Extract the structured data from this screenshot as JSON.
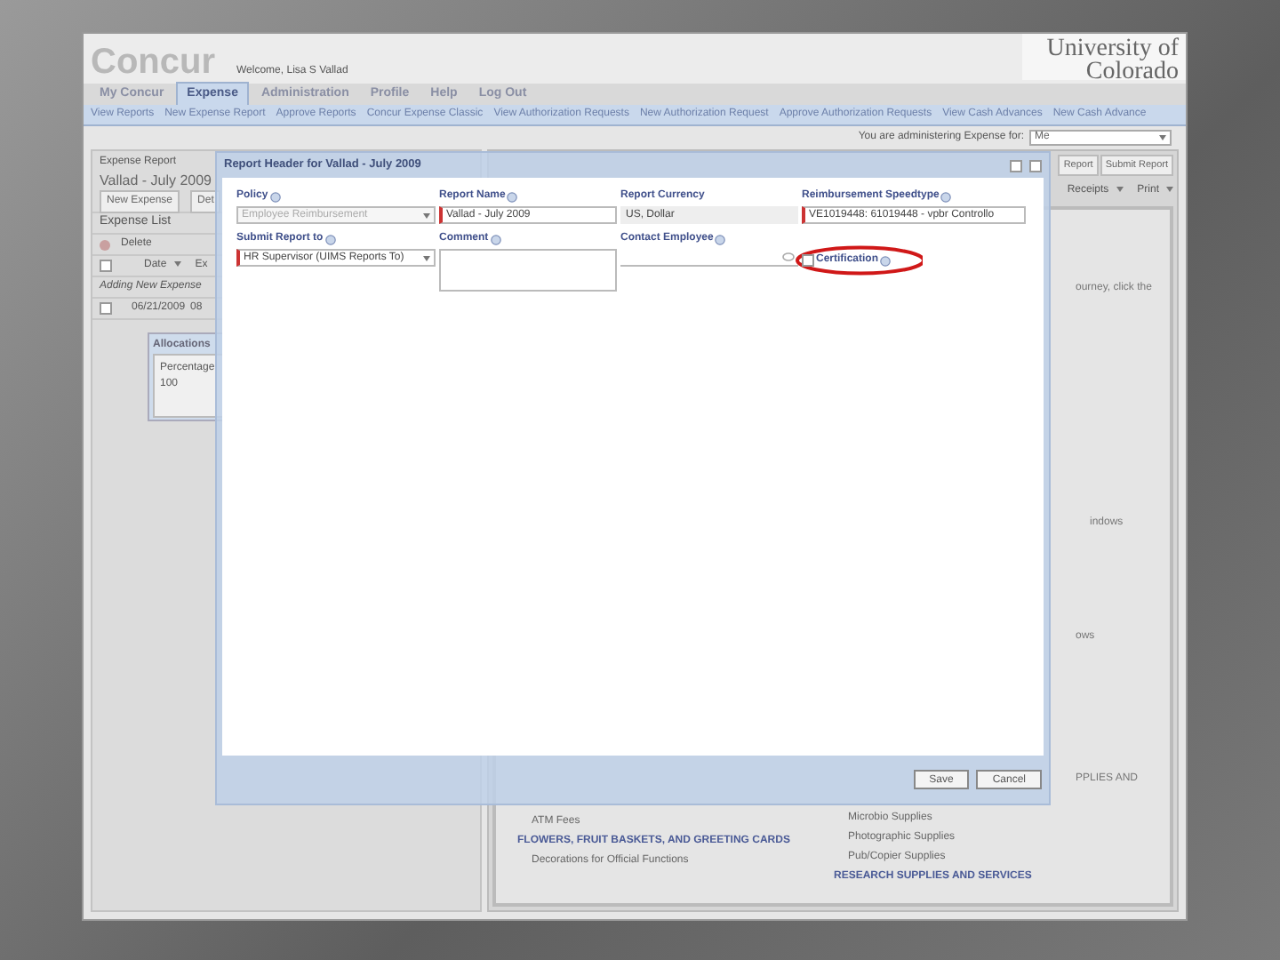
{
  "header": {
    "logo": "Concur",
    "welcome": "Welcome, Lisa S Vallad",
    "university": "University of Colorado"
  },
  "main_tabs": [
    {
      "label": "My Concur",
      "selected": false
    },
    {
      "label": "Expense",
      "selected": true
    },
    {
      "label": "Administration",
      "selected": false
    },
    {
      "label": "Profile",
      "selected": false
    },
    {
      "label": "Help",
      "selected": false
    },
    {
      "label": "Log Out",
      "selected": false
    }
  ],
  "sub_nav": [
    "View Reports",
    "New Expense Report",
    "Approve Reports",
    "Concur Expense Classic",
    "View Authorization Requests",
    "New Authorization Request",
    "Approve Authorization Requests",
    "View Cash Advances",
    "New Cash Advance"
  ],
  "admin_bar": {
    "label": "You are administering Expense for:",
    "value": "Me"
  },
  "report": {
    "breadcrumb": "Expense Report",
    "title": "Vallad - July 2009",
    "toolbar": [
      "New Expense",
      "Det"
    ],
    "list_title": "Expense List",
    "delete": "Delete",
    "columns": [
      "Date",
      "Ex"
    ],
    "select_all_checked": false,
    "adding_row": "Adding New Expense",
    "rows": [
      {
        "date": "06/21/2009",
        "column_2": "08",
        "checked": false
      }
    ]
  },
  "allocations": {
    "title": "Allocations",
    "column": "Percentage",
    "value": "100"
  },
  "right_panel": {
    "buttons": [
      "Report",
      "Submit Report"
    ],
    "menus": [
      "Receipts",
      "Print"
    ],
    "fragments": [
      "ourney, click the",
      "indows",
      "ows",
      "PPLIES AND"
    ],
    "categories_left": [
      {
        "text": "ATM Fees",
        "kind": "item"
      },
      {
        "text": "FLOWERS, FRUIT BASKETS, AND GREETING CARDS",
        "kind": "heading"
      },
      {
        "text": "Decorations for Official Functions",
        "kind": "item"
      }
    ],
    "categories_right": [
      {
        "text": "Microbio Supplies",
        "kind": "item"
      },
      {
        "text": "Photographic Supplies",
        "kind": "item"
      },
      {
        "text": "Pub/Copier Supplies",
        "kind": "item"
      },
      {
        "text": "RESEARCH SUPPLIES AND SERVICES",
        "kind": "heading"
      }
    ]
  },
  "dialog": {
    "title": "Report Header for Vallad - July 2009",
    "fields": [
      {
        "label": "Policy",
        "kind": "select",
        "value": "Employee Reimbursement",
        "required": false,
        "disabled": true
      },
      {
        "label": "Report Name",
        "kind": "text",
        "value": "Vallad - July 2009",
        "required": true,
        "disabled": false
      },
      {
        "label": "Report Currency",
        "kind": "readonly",
        "value": "US, Dollar",
        "required": false,
        "disabled": false
      },
      {
        "label": "Reimbursement Speedtype",
        "kind": "text",
        "value": "VE1019448: 61019448 - vpbr Controllo",
        "required": true,
        "disabled": false
      },
      {
        "label": "Submit Report to",
        "kind": "select",
        "value": "HR Supervisor (UIMS Reports To)",
        "required": true,
        "disabled": false
      },
      {
        "label": "Comment",
        "kind": "textarea",
        "required": false
      },
      {
        "label": "Contact Employee",
        "kind": "lookup",
        "required": false
      },
      {
        "label": "Certification",
        "kind": "checkbox",
        "checked": false,
        "highlighted": true
      }
    ],
    "buttons": [
      "Save",
      "Cancel"
    ]
  }
}
